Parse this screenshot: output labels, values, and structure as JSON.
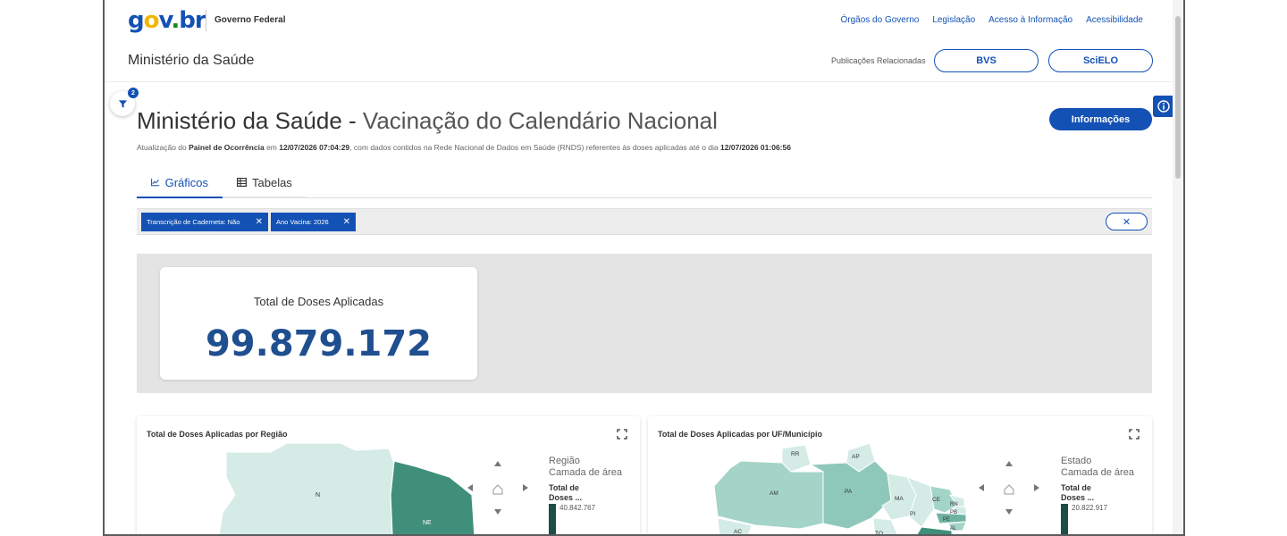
{
  "header": {
    "logo": {
      "g": "g",
      "o": "o",
      "v": "v",
      "dot": ".",
      "br": "br"
    },
    "gov_federal": "Governo Federal",
    "links": [
      "Órgãos do Governo",
      "Legislação",
      "Acesso à Informação",
      "Acessibilidade"
    ],
    "ministry": "Ministério da Saúde",
    "publications_label": "Publicações Relacionadas",
    "bvs": "BVS",
    "scielo": "SciELO"
  },
  "filter_fab": {
    "badge": "2"
  },
  "page": {
    "title_main": "Ministério da Saúde",
    "title_sep": " - ",
    "title_sub": "Vacinação do Calendário Nacional",
    "info_button": "Informações",
    "update": {
      "t1": "Atualização do ",
      "b1": "Painel de Ocorrência",
      "t2": " em ",
      "b2": "12/07/2026 07:04:29",
      "t3": ", com dados contidos na Rede Nacional de Dados em Saúde (RNDS) referentes às doses aplicadas até o dia ",
      "b3": "12/07/2026 01:06:56"
    }
  },
  "tabs": [
    {
      "label": "Gráficos",
      "icon": "line-chart-icon",
      "active": true
    },
    {
      "label": "Tabelas",
      "icon": "table-icon",
      "active": false
    }
  ],
  "filters": {
    "chips": [
      {
        "label": "Transcrição de Caderneta: Não"
      },
      {
        "label": "Ano Vacina: 2026"
      }
    ],
    "close_glyph": "✕",
    "clear_glyph": "✕"
  },
  "kpi": {
    "label": "Total de Doses Aplicadas",
    "value": "99.879.172"
  },
  "panels": {
    "left": {
      "title": "Total de Doses Aplicadas por Região",
      "legend_title_1": "Região",
      "legend_title_2": "Camada de área",
      "legend_measure_1": "Total de",
      "legend_measure_2": "Doses ...",
      "legend_max": "40.842.767",
      "labels": {
        "n": "N",
        "ne": "NE"
      }
    },
    "right": {
      "title": "Total de Doses Aplicadas por UF/Município",
      "legend_title_1": "Estado",
      "legend_title_2": "Camada de área",
      "legend_measure_1": "Total de",
      "legend_measure_2": "Doses ...",
      "legend_max": "20.822.917",
      "labels": {
        "rr": "RR",
        "ap": "AP",
        "am": "AM",
        "pa": "PA",
        "ma": "MA",
        "ce": "CE",
        "rn": "RN",
        "pb": "PB",
        "pi": "PI",
        "pe": "PE",
        "al": "AL",
        "ac": "AC",
        "to": "TO"
      }
    }
  },
  "colors": {
    "primary": "#1351b4",
    "kpi_value": "#1f4f8f",
    "map_light": "#d4ebe6",
    "map_mid": "#a4d4c8",
    "map_dark": "#3f8f7a"
  }
}
